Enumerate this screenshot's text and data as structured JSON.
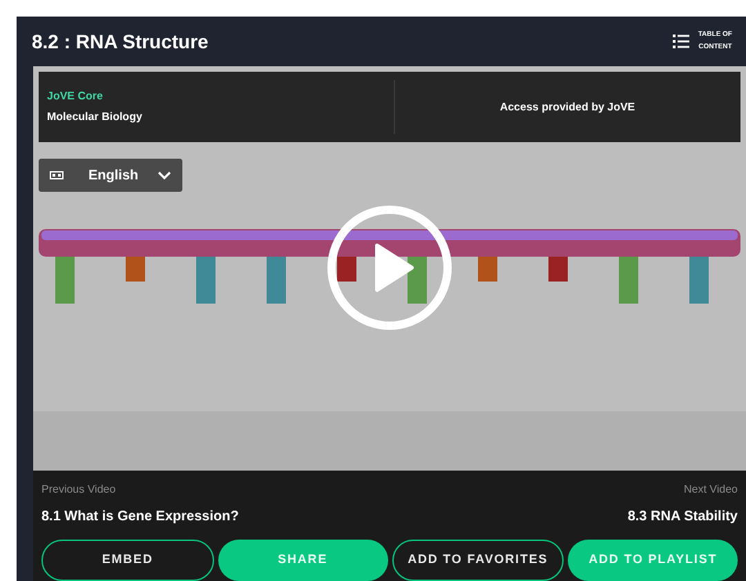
{
  "title": "8.2 : RNA Structure",
  "toc": {
    "label_lines": [
      "TABLE OF",
      "CONTENT"
    ]
  },
  "info_bar": {
    "collection": "JoVE Core",
    "subject": "Molecular Biology",
    "access": "Access provided by JoVE"
  },
  "language": {
    "value": "English"
  },
  "previous": {
    "label": "Previous Video",
    "title": "8.1 What is Gene Expression?"
  },
  "next": {
    "label": "Next Video",
    "title": "8.3 RNA Stability"
  },
  "buttons": [
    {
      "label": "EMBED",
      "kind": "outline"
    },
    {
      "label": "SHARE",
      "kind": "filled"
    },
    {
      "label": "ADD TO FAVORITES",
      "kind": "outline"
    },
    {
      "label": "ADD TO PLAYLIST",
      "kind": "filled"
    }
  ]
}
